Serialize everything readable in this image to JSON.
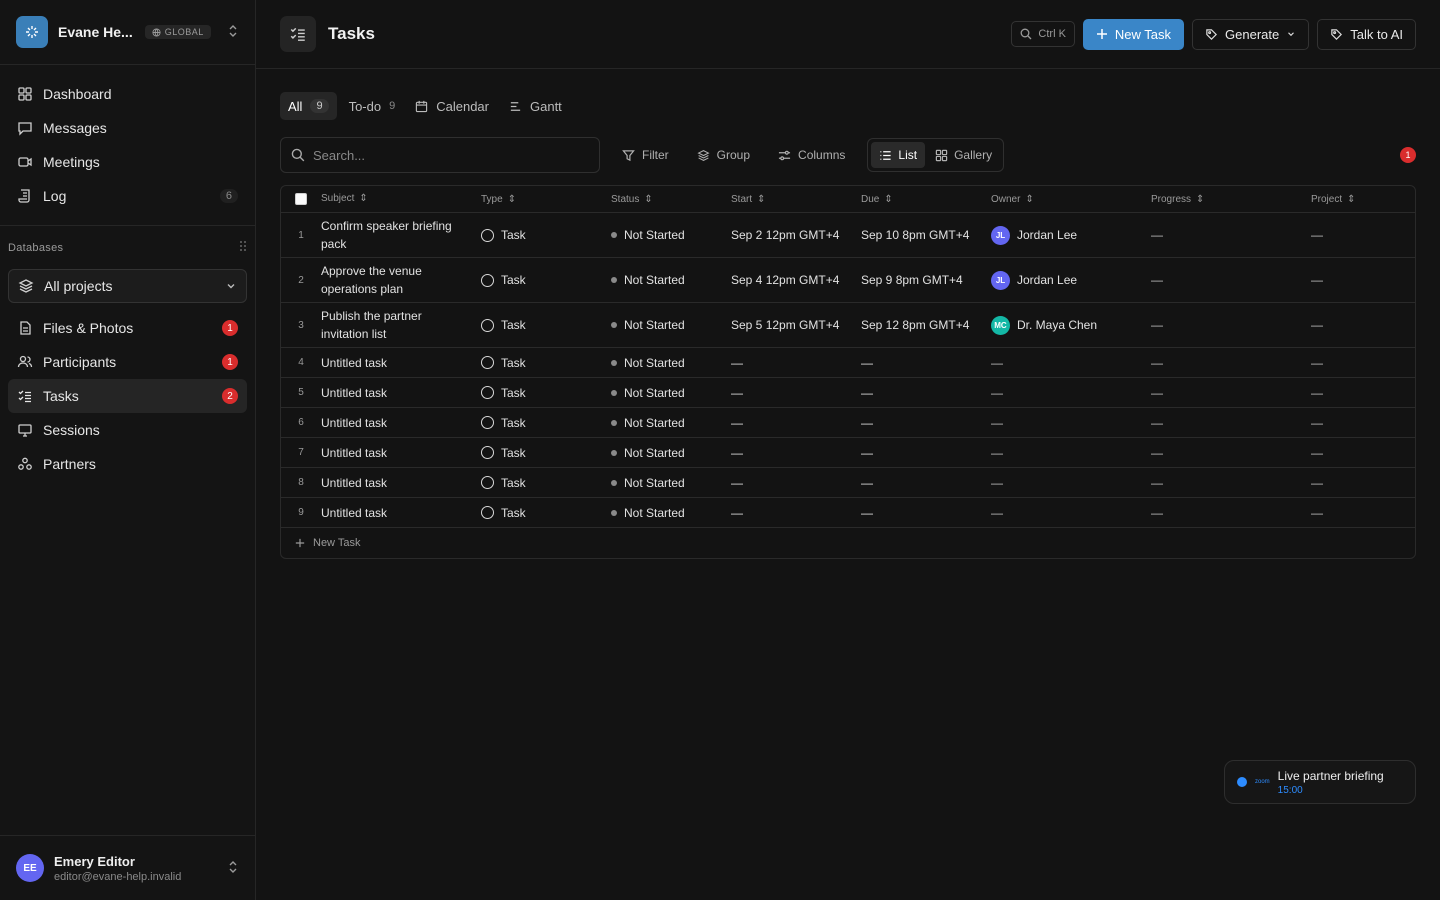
{
  "workspace": {
    "name": "Evane He...",
    "badge": "GLOBAL"
  },
  "nav_top": [
    {
      "label": "Dashboard",
      "icon": "grid-icon"
    },
    {
      "label": "Messages",
      "icon": "message-icon"
    },
    {
      "label": "Meetings",
      "icon": "video-icon"
    },
    {
      "label": "Log",
      "icon": "scroll-icon",
      "count": "6"
    }
  ],
  "databases": {
    "heading": "Databases",
    "selector": "All projects",
    "items": [
      {
        "label": "Files & Photos",
        "badge": "1"
      },
      {
        "label": "Participants",
        "badge": "1"
      },
      {
        "label": "Tasks",
        "badge": "2"
      },
      {
        "label": "Sessions"
      },
      {
        "label": "Partners"
      }
    ]
  },
  "user": {
    "initials": "EE",
    "name": "Emery Editor",
    "email": "editor@evane-help.invalid"
  },
  "header": {
    "title": "Tasks",
    "shortcut": "Ctrl K",
    "new_task": "New Task",
    "generate": "Generate",
    "talk_ai": "Talk to AI"
  },
  "tabs": [
    {
      "label": "All",
      "count": "9"
    },
    {
      "label": "To-do",
      "count": "9"
    },
    {
      "label": "Calendar"
    },
    {
      "label": "Gantt"
    }
  ],
  "toolbar": {
    "search_placeholder": "Search...",
    "filter": "Filter",
    "group": "Group",
    "columns": "Columns",
    "list": "List",
    "gallery": "Gallery",
    "notification_count": "1"
  },
  "table": {
    "headers": [
      "Subject",
      "Type",
      "Status",
      "Start",
      "Due",
      "Owner",
      "Progress",
      "Project"
    ],
    "rows": [
      {
        "num": "1",
        "subject": "Confirm speaker briefing pack",
        "type": "Task",
        "status": "Not Started",
        "start": "Sep 2 12pm GMT+4",
        "due": "Sep 10 8pm GMT+4",
        "owner": "Jordan Lee",
        "owner_initials": "JL",
        "progress": "—",
        "project": "—"
      },
      {
        "num": "2",
        "subject": "Approve the venue operations plan",
        "type": "Task",
        "status": "Not Started",
        "start": "Sep 4 12pm GMT+4",
        "due": "Sep 9 8pm GMT+4",
        "owner": "Jordan Lee",
        "owner_initials": "JL",
        "progress": "—",
        "project": "—"
      },
      {
        "num": "3",
        "subject": "Publish the partner invitation list",
        "type": "Task",
        "status": "Not Started",
        "start": "Sep 5 12pm GMT+4",
        "due": "Sep 12 8pm GMT+4",
        "owner": "Dr. Maya Chen",
        "owner_initials": "MC",
        "progress": "—",
        "project": "—"
      },
      {
        "num": "4",
        "subject": "Untitled task",
        "type": "Task",
        "status": "Not Started",
        "start": "—",
        "due": "—",
        "owner": "—",
        "progress": "—",
        "project": "—"
      },
      {
        "num": "5",
        "subject": "Untitled task",
        "type": "Task",
        "status": "Not Started",
        "start": "—",
        "due": "—",
        "owner": "—",
        "progress": "—",
        "project": "—"
      },
      {
        "num": "6",
        "subject": "Untitled task",
        "type": "Task",
        "status": "Not Started",
        "start": "—",
        "due": "—",
        "owner": "—",
        "progress": "—",
        "project": "—"
      },
      {
        "num": "7",
        "subject": "Untitled task",
        "type": "Task",
        "status": "Not Started",
        "start": "—",
        "due": "—",
        "owner": "—",
        "progress": "—",
        "project": "—"
      },
      {
        "num": "8",
        "subject": "Untitled task",
        "type": "Task",
        "status": "Not Started",
        "start": "—",
        "due": "—",
        "owner": "—",
        "progress": "—",
        "project": "—"
      },
      {
        "num": "9",
        "subject": "Untitled task",
        "type": "Task",
        "status": "Not Started",
        "start": "—",
        "due": "—",
        "owner": "—",
        "progress": "—",
        "project": "—"
      }
    ],
    "new_row": "New Task"
  },
  "meeting": {
    "title": "Live partner briefing",
    "time": "15:00",
    "provider": "zoom"
  },
  "colors": {
    "accent": "#3a86c8",
    "badge_red": "#d92d2d",
    "jl_avatar": "#6366f1",
    "mc_avatar": "#14b8a6"
  }
}
